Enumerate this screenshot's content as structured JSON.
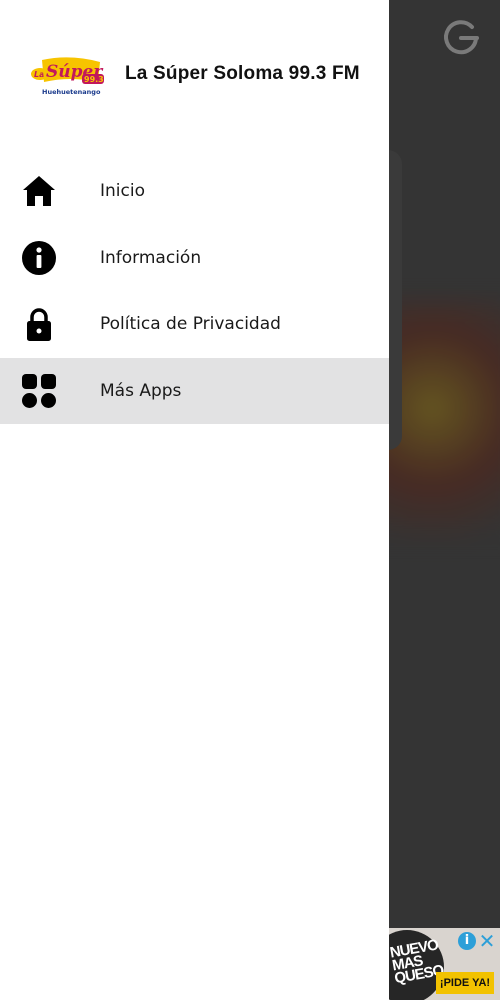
{
  "app": {
    "station_name": "La Súper Soloma 99.3 FM",
    "logo": {
      "wordmark": "Súper",
      "prefix": "La",
      "frequency": "99.3",
      "location": "Huehuetenango"
    }
  },
  "menu": {
    "items": [
      {
        "label": "Inicio",
        "icon": "home-icon",
        "active": false
      },
      {
        "label": "Información",
        "icon": "info-icon",
        "active": false
      },
      {
        "label": "Política de Privacidad",
        "icon": "lock-icon",
        "active": false
      },
      {
        "label": "Más Apps",
        "icon": "apps-grid-icon",
        "active": true
      }
    ]
  },
  "background_app": {
    "power_icon": "power-icon"
  },
  "ad": {
    "text": "NUEVO MAS QUESO",
    "cta": "¡PIDE YA!",
    "info_icon": "i",
    "close_icon": "✕"
  },
  "colors": {
    "drawer_bg": "#ffffff",
    "active_item_bg": "#e2e2e3",
    "icon_color": "#000000",
    "scrim": "#343434",
    "ad_cta": "#f2c200",
    "ad_info": "#2d9fd8"
  }
}
